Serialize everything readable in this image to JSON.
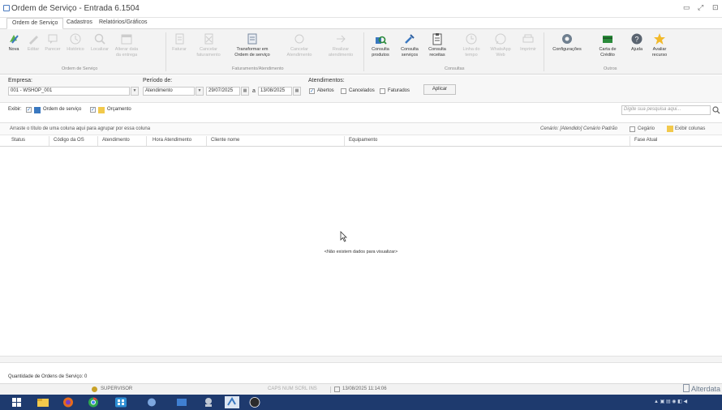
{
  "window": {
    "title": "Ordem de Serviço - Entrada 6.1504",
    "controls": [
      "▭",
      "⤢",
      "⊡"
    ]
  },
  "menu_tabs": [
    "Ordem de Serviço",
    "Cadastros",
    "Relatórios/Gráficos"
  ],
  "ribbon": {
    "groups": {
      "ordem": "Ordem de Serviço",
      "fat": "Faturamento/Atendimento",
      "consultas": "Consultas",
      "outros": "Outros"
    },
    "buttons": [
      {
        "label": "Nova",
        "icon": "new-icon"
      },
      {
        "label": "Editar",
        "icon": "edit-icon"
      },
      {
        "label": "Parecer",
        "icon": "comment-icon"
      },
      {
        "label": "Histórico",
        "icon": "history-icon"
      },
      {
        "label": "Localizar",
        "icon": "search-icon"
      },
      {
        "label": "Alterar data da entrega",
        "icon": "calendar-icon"
      },
      {
        "label": "Faturar",
        "icon": "invoice-icon"
      },
      {
        "label": "Cancelar faturamento",
        "icon": "cancel-invoice-icon"
      },
      {
        "label": "Transformar em Ordem de serviço",
        "icon": "transform-icon"
      },
      {
        "label": "Cancelar Atendimento",
        "icon": "cancel-attendance-icon"
      },
      {
        "label": "Realizar atendimento",
        "icon": "perform-attendance-icon"
      },
      {
        "label": "Consulta produtos",
        "icon": "products-icon"
      },
      {
        "label": "Consulta serviços",
        "icon": "services-icon"
      },
      {
        "label": "Consulta receitas",
        "icon": "recipes-icon"
      },
      {
        "label": "Linha do tempo",
        "icon": "timeline-icon"
      },
      {
        "label": "WhatsApp Web",
        "icon": "whatsapp-icon"
      },
      {
        "label": "Imprimir",
        "icon": "print-icon"
      },
      {
        "label": "Configurações",
        "icon": "gear-icon"
      },
      {
        "label": "Carta de Crédito",
        "icon": "credit-card-icon"
      },
      {
        "label": "Ajuda",
        "icon": "help-icon"
      },
      {
        "label": "Avaliar recurso",
        "icon": "star-icon"
      }
    ]
  },
  "filters": {
    "empresa_label": "Empresa:",
    "empresa_value": "001 - WSHOP_001",
    "periodo_label": "Período de:",
    "periodo_type": "Atendimento",
    "date_from": "29/07/2025",
    "date_sep": "a",
    "date_to": "13/08/2025",
    "atendimentos_label": "Atendimentos:",
    "abertos": "Abertos",
    "cancelados": "Cancelados",
    "faturados": "Faturados",
    "aplicar": "Aplicar"
  },
  "exibir": {
    "label": "Exibir:",
    "ordem": "Ordem de serviço",
    "orcamento": "Orçamento"
  },
  "search": {
    "placeholder": "Digite sua pesquisa aqui..."
  },
  "grid": {
    "group_hint": "Arraste o título de uma coluna aqui para agrupar por essa coluna",
    "cenario": "Cenário: [Atendido] Cenário Padrão",
    "cegueiro": "Cegário",
    "exibir_colunas": "Exibir colunas",
    "columns": [
      "Status",
      "Código da OS",
      "Atendimento",
      "Hora Atendimento",
      "Cliente nome",
      "Equipamento",
      "Fase Atual"
    ],
    "empty": "<Não existem dados para visualizar>"
  },
  "footer": {
    "count": "Quantidade de Ordens de Serviço: 0"
  },
  "statusbar": {
    "user": "SUPERVISOR",
    "keys": "CAPS  NUM  SCRL  INS",
    "datetime": "13/08/2025 11:14:06",
    "brand": "Alterdata"
  }
}
